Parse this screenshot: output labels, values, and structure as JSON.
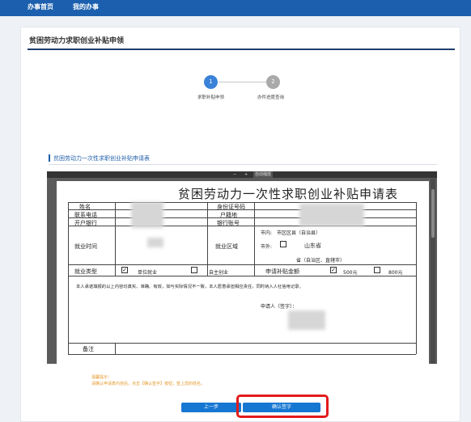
{
  "nav": {
    "items": [
      "办事首页",
      "我的办事"
    ]
  },
  "page_title": "贫困劳动力求职创业补贴申领",
  "steps": [
    {
      "number": "1",
      "label": "求职补贴申领",
      "active": true
    },
    {
      "number": "2",
      "label": "办件进度查询",
      "active": false
    }
  ],
  "section_title": "贫困劳动力一次性求职创业补贴申请表",
  "viewer_toolbar": {
    "minus": "−",
    "plus": "+",
    "zoom": "自动缩放"
  },
  "form": {
    "title": "贫困劳动力一次性求职创业补贴申请表",
    "labels": {
      "name": "姓名",
      "id_number": "身份证号码",
      "phone": "联系电话",
      "household": "户籍地",
      "bank": "开户银行",
      "account": "银行账号",
      "employment_time": "就业时间",
      "employment_area": "就业区域",
      "employment_type": "就业类型",
      "amount": "申请补贴金额",
      "remark": "备注"
    },
    "area": {
      "in_city": "市内:",
      "in_city_value": "市区区县（自治县）",
      "out_city": "市外:",
      "out_city_value": "山东省",
      "province_line": "省（自治区、直辖市）"
    },
    "employment_types": [
      {
        "label": "单位就业",
        "checked": true
      },
      {
        "label": "自主创业",
        "checked": false
      }
    ],
    "amounts": [
      {
        "label": "500元",
        "checked": true
      },
      {
        "label": "800元",
        "checked": false
      }
    ],
    "statement": "本人承诺填报的以上内容均真实、准确、有效，如与实际情况不一致，本人愿意承担相应责任，同时纳入人社信用记录。",
    "signature_label": "申请人（签字）："
  },
  "hint": {
    "title": "温馨提示：",
    "text": "请确认申请表内容后，点击【确认签字】按钮，签上您的姓名。"
  },
  "buttons": {
    "prev": "上一步",
    "confirm": "确认签字"
  },
  "colors": {
    "nav": "#1b5fae",
    "accent": "#1677d2",
    "step_active": "#3a83d8",
    "step_inactive": "#a9a9a9",
    "hint": "#e39a2c",
    "highlight": "#e31b1b"
  }
}
